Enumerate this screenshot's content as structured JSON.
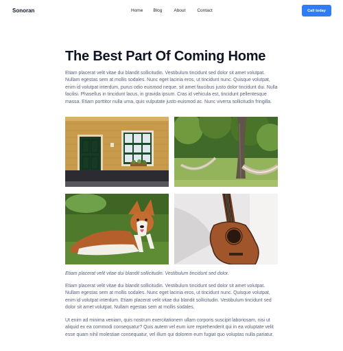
{
  "header": {
    "brand": "Sonoran",
    "nav": [
      "Home",
      "Blog",
      "About",
      "Contact"
    ],
    "cta": "Call today"
  },
  "article": {
    "title": "The Best Part Of Coming Home",
    "p1": "Etiam placerat velit vitae dui blandit sollicitudin. Vestibulum tincidunt sed dolor sit amet volutpat. Nullam egestas sem at mollis sodales. Nunc eget lacinia eros, ut tincidunt nunc. Quisque volutpat, enim id volutpat interdum, purus odio euismod neque, sit amet faucibus justo dolor tincidunt dui. Nulla facilisi. Phasellus in tincidunt lacus, in gravida ipsum. Cras id vehicula est, tincidunt pellentesque massa. Etiam porttitor nulla urna, quis vulputate justo euismod ac. Nunc viverra sollicitudin fringilla.",
    "caption": "Etiam placerat velit vitae dui blandit sollicitudin. Vestibulum tincidunt sed dolor.",
    "p2": "Etiam placerat velit vitae dui blandit sollicitudin. Vestibulum tincidunt sed dolor sit amet volutpat. Nullam egestas sem at mollis sodales. Nunc eget lacinia eros, ut tincidunt nunc. Quisque volutpat, enim id volutpat interdum. Etiam placerat velit vitae dui blandit sollicitudin. Vestibulum tincidunt sed dolor sit amet volutpat. Nullam egestas sem at mollis sodales.",
    "p3": "Ut enim ad minima veniam, quis nostrum exercitationem ullam corporis suscipit laboriosam, nisi ut aliquid ex ea commodi consequatur? Quis autem vel eum iure reprehenderit qui in ea voluptate velit esse quam nihil molestiae consequatur, vel illum qui dolorem eum fugiat quo voluptas nulla pariatur."
  },
  "colors": {
    "accent": "#2f7cf6",
    "heading": "#0f1424",
    "body_text": "#55617a"
  }
}
